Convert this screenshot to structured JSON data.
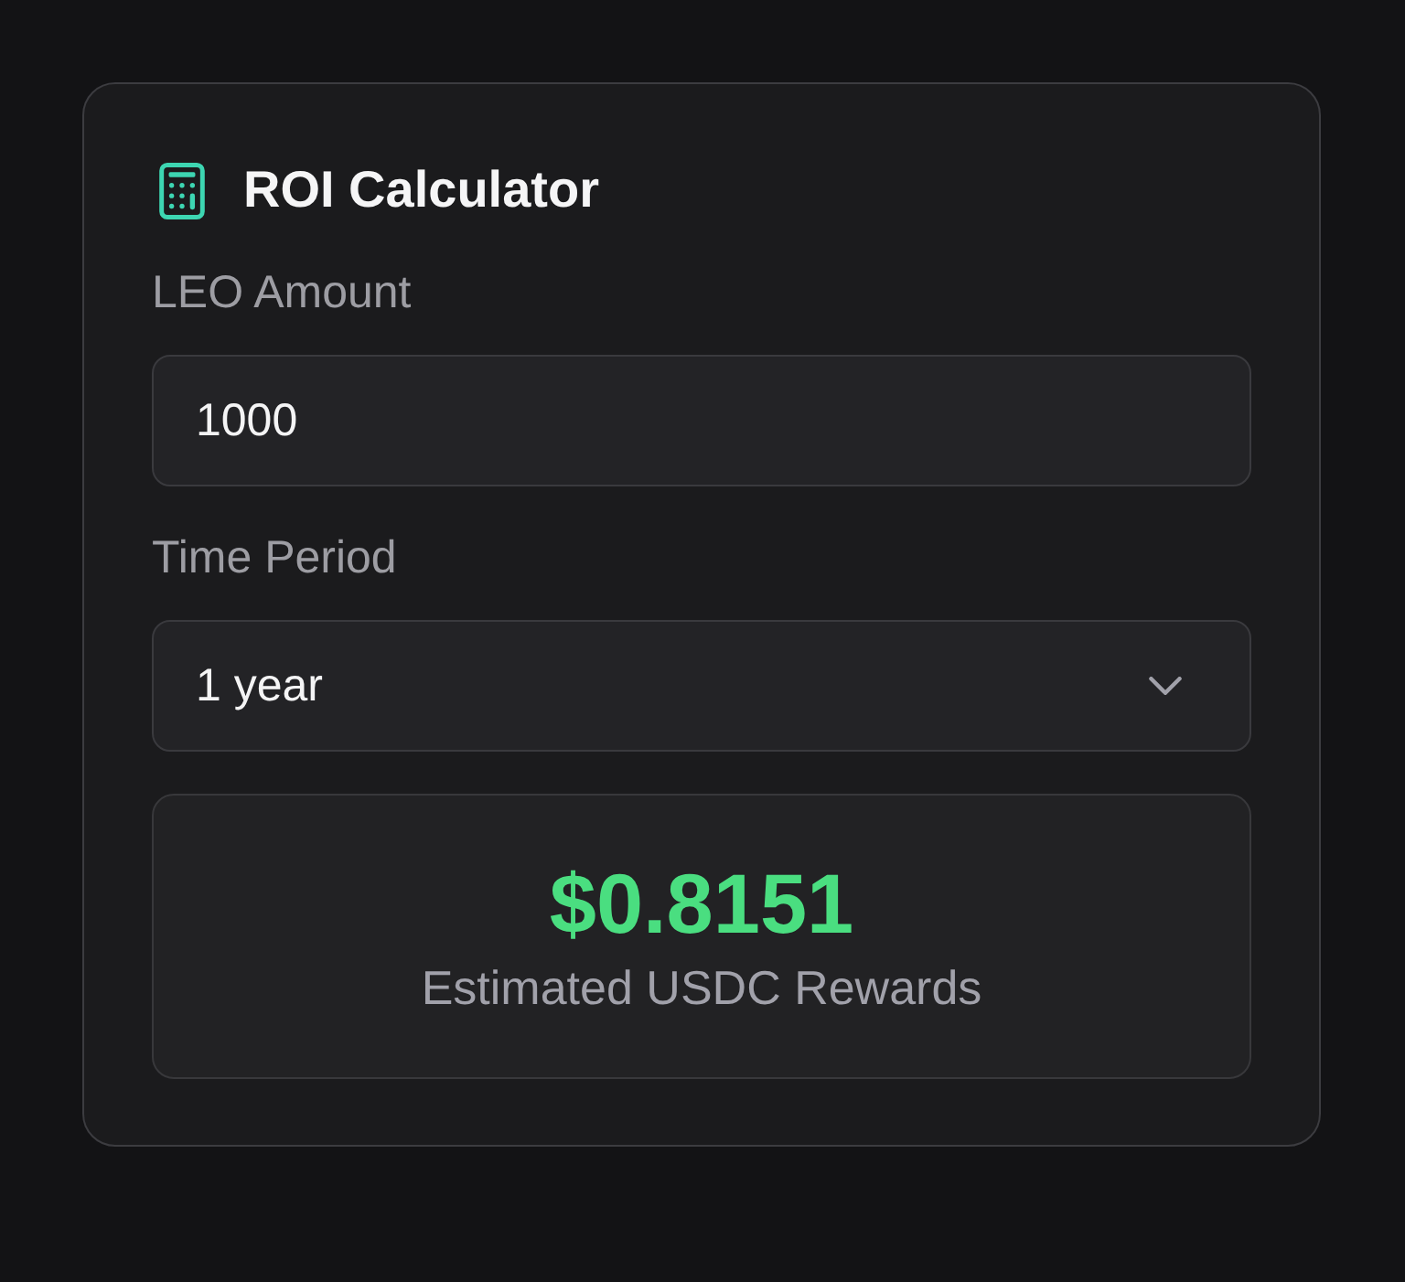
{
  "header": {
    "title": "ROI Calculator"
  },
  "fields": [
    {
      "kind": "input",
      "label": "LEO Amount",
      "value": "1000"
    },
    {
      "kind": "select",
      "label": "Time Period",
      "value": "1 year"
    }
  ],
  "result": {
    "amount": "$0.8151",
    "caption": "Estimated USDC Rewards"
  }
}
